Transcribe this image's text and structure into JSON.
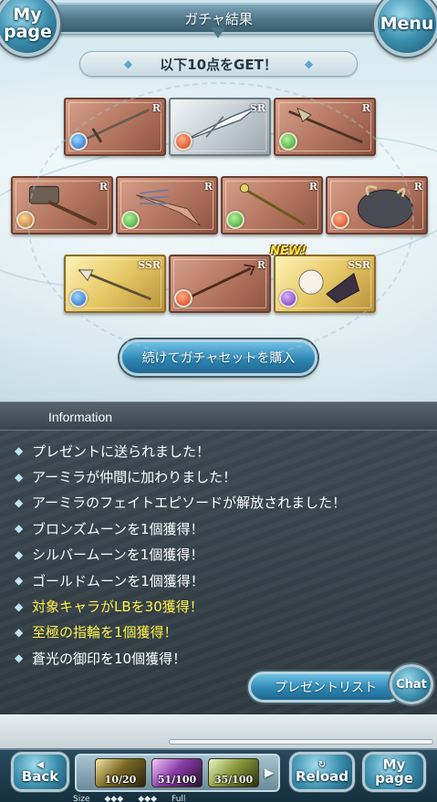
{
  "header": {
    "title": "ガチャ結果",
    "mypage_label": "My page",
    "menu_label": "Menu"
  },
  "banner": {
    "text": "以下10点をGET！"
  },
  "items": [
    {
      "rarity": "R",
      "element": "water",
      "art": "sword"
    },
    {
      "rarity": "SR",
      "element": "fire",
      "art": "silver-spear"
    },
    {
      "rarity": "R",
      "element": "wind",
      "art": "lance"
    },
    {
      "rarity": "R",
      "element": "earth",
      "art": "hammer"
    },
    {
      "rarity": "R",
      "element": "wind",
      "art": "claw"
    },
    {
      "rarity": "R",
      "element": "wind",
      "art": "staff"
    },
    {
      "rarity": "R",
      "element": "fire",
      "art": "beast"
    },
    {
      "rarity": "SSR",
      "element": "water",
      "art": "harpoon"
    },
    {
      "rarity": "R",
      "element": "fire",
      "art": "trident"
    },
    {
      "rarity": "SSR",
      "element": "dark",
      "art": "character"
    }
  ],
  "new_badge": "NEW!",
  "continue_button": "続けてガチャセットを購入",
  "information": {
    "header": "Information",
    "messages": [
      {
        "text": "プレゼントに送られました！",
        "highlight": false
      },
      {
        "text": "アーミラが仲間に加わりました！",
        "highlight": false
      },
      {
        "text": "アーミラのフェイトエピソードが解放されました！",
        "highlight": false
      },
      {
        "text": "ブロンズムーンを1個獲得！",
        "highlight": false
      },
      {
        "text": "シルバームーンを1個獲得！",
        "highlight": false
      },
      {
        "text": "ゴールドムーンを1個獲得！",
        "highlight": false
      },
      {
        "text": "対象キャラがLBを30獲得！",
        "highlight": true
      },
      {
        "text": "至極の指輪を1個獲得！",
        "highlight": true
      },
      {
        "text": "蒼光の御印を10個獲得！",
        "highlight": false
      }
    ],
    "present_list_button": "プレゼントリスト",
    "chat_button": "Chat"
  },
  "footer": {
    "back_label": "Back",
    "reload_label": "Reload",
    "mypage_label": "My page",
    "gauges": [
      "10/20",
      "51/100",
      "35/100"
    ],
    "size_label": "Size",
    "full_label": "Full"
  },
  "colors": {
    "highlight_text": "#fff24a",
    "accent_blue": "#2f87b4"
  }
}
